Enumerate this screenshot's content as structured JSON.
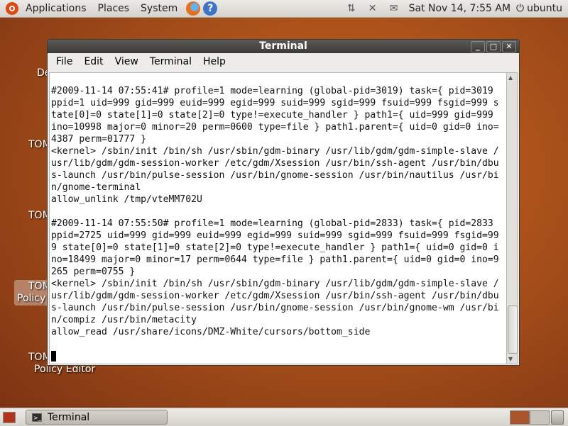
{
  "top_panel": {
    "menus": [
      "Applications",
      "Places",
      "System"
    ],
    "clock": "Sat Nov 14,  7:55 AM",
    "user": "ubuntu"
  },
  "desktop": {
    "icons": [
      {
        "label": "De"
      },
      {
        "label": "TOM"
      },
      {
        "label": "TOM"
      },
      {
        "label_line1": "TOM",
        "label_line2": "Policy"
      },
      {
        "label_line1": "TOM",
        "label_line2": "Policy Editor"
      }
    ]
  },
  "terminal": {
    "title": "Terminal",
    "menu": [
      "File",
      "Edit",
      "View",
      "Terminal",
      "Help"
    ],
    "lines": [
      "#2009-11-14 07:55:41# profile=1 mode=learning (global-pid=3019) task={ pid=3019",
      "ppid=1 uid=999 gid=999 euid=999 egid=999 suid=999 sgid=999 fsuid=999 fsgid=999 s",
      "tate[0]=0 state[1]=0 state[2]=0 type!=execute_handler } path1={ uid=999 gid=999",
      "ino=10998 major=0 minor=20 perm=0600 type=file } path1.parent={ uid=0 gid=0 ino=",
      "4387 perm=01777 }",
      "<kernel> /sbin/init /bin/sh /usr/sbin/gdm-binary /usr/lib/gdm/gdm-simple-slave /",
      "usr/lib/gdm/gdm-session-worker /etc/gdm/Xsession /usr/bin/ssh-agent /usr/bin/dbu",
      "s-launch /usr/bin/pulse-session /usr/bin/gnome-session /usr/bin/nautilus /usr/bi",
      "n/gnome-terminal",
      "allow_unlink /tmp/vteMM702U",
      "",
      "#2009-11-14 07:55:50# profile=1 mode=learning (global-pid=2833) task={ pid=2833",
      "ppid=2725 uid=999 gid=999 euid=999 egid=999 suid=999 sgid=999 fsuid=999 fsgid=99",
      "9 state[0]=0 state[1]=0 state[2]=0 type!=execute_handler } path1={ uid=0 gid=0 i",
      "no=18499 major=0 minor=17 perm=0644 type=file } path1.parent={ uid=0 gid=0 ino=9",
      "265 perm=0755 }",
      "<kernel> /sbin/init /bin/sh /usr/sbin/gdm-binary /usr/lib/gdm/gdm-simple-slave /",
      "usr/lib/gdm/gdm-session-worker /etc/gdm/Xsession /usr/bin/ssh-agent /usr/bin/dbu",
      "s-launch /usr/bin/pulse-session /usr/bin/gnome-session /usr/bin/gnome-wm /usr/bi",
      "n/compiz /usr/bin/metacity",
      "allow_read /usr/share/icons/DMZ-White/cursors/bottom_side"
    ]
  },
  "taskbar": {
    "task_label": "Terminal"
  },
  "colors": {
    "panel": "#e0ded9",
    "desktop": "#a8501a",
    "titlebar": "#3c3b37"
  }
}
